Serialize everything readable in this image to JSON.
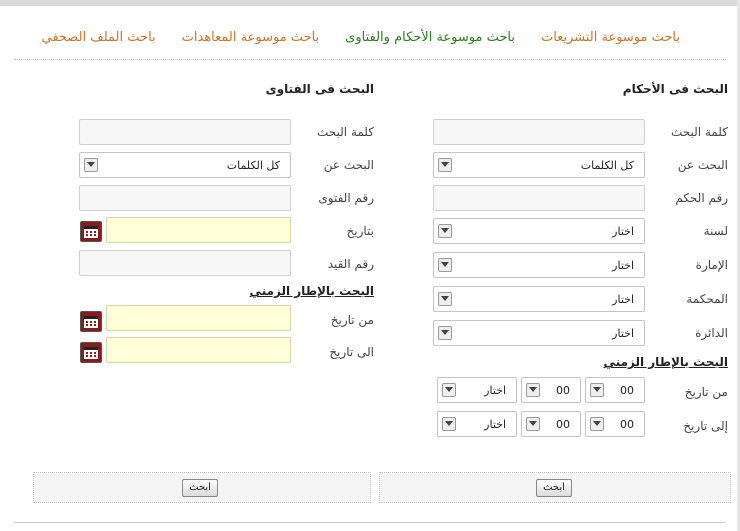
{
  "tabs": [
    "باحث موسوعة التشريعات",
    "باحث موسوعة الأحكام والفتاوى",
    "باحث موسوعة المعاهدات",
    "باحث الملف الصحفي"
  ],
  "rulings": {
    "title": "البحث فى الأحكام",
    "keyword_label": "كلمة البحث",
    "search_in_label": "البحث عن",
    "search_in_value": "كل الكلمات",
    "ruling_no_label": "رقم الحكم",
    "year_label": "لسنة",
    "year_value": "اختار",
    "emirate_label": "الإمارة",
    "emirate_value": "اختار",
    "court_label": "المحكمة",
    "court_value": "اختار",
    "circuit_label": "الدائرة",
    "circuit_value": "اختار",
    "timeframe_title": "البحث بالإطار الزمني",
    "from_label": "من تاريخ",
    "to_label": "إلى تاريخ",
    "from_day": "00",
    "from_month": "00",
    "from_year": "اختار",
    "to_day": "00",
    "to_month": "00",
    "to_year": "اختار",
    "search_button": "ابحث"
  },
  "fatwas": {
    "title": "البحث فى الفتاوى",
    "keyword_label": "كلمة البحث",
    "search_in_label": "البحث عن",
    "search_in_value": "كل الكلمات",
    "fatwa_no_label": "رقم الفتوى",
    "date_label": "بتاريخ",
    "record_no_label": "رقم القيد",
    "timeframe_title": "البحث بالإطار الزمني",
    "from_label": "من تاريخ",
    "to_label": "الى تاريخ",
    "search_button": "ابحث"
  },
  "colors": {
    "tab": "#c8742c",
    "tab_active": "#2e7d1e",
    "date_field": "#ffffd8",
    "calendar": "#8b1a1a"
  }
}
